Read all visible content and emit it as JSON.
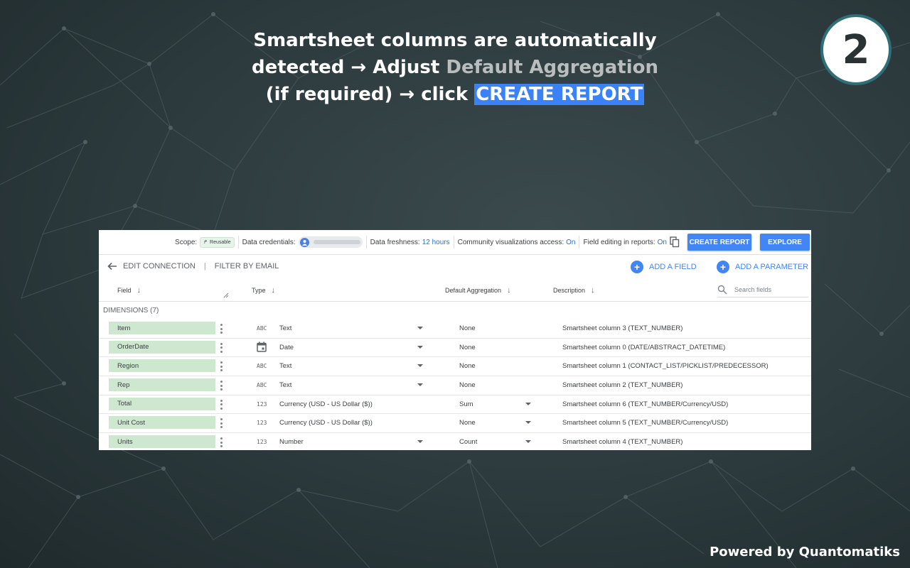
{
  "headline": {
    "line1": "Smartsheet columns are automatically",
    "line2_pre": "detected → Adjust ",
    "line2_gray": "Default Aggregation",
    "line3_pre": "(if required) → click ",
    "line3_highlight": "CREATE REPORT"
  },
  "step_number": "2",
  "footer": "Powered by Quantomatiks",
  "topbar": {
    "scope_label": "Scope:",
    "scope_chip": "Reusable",
    "credentials_label": "Data credentials:",
    "freshness_label": "Data freshness:",
    "freshness_value": "12 hours",
    "community_label": "Community visualizations access:",
    "community_value": "On",
    "field_editing_label": "Field editing in reports:",
    "field_editing_value": "On",
    "create_report": "CREATE REPORT",
    "explore": "EXPLORE"
  },
  "toolbar": {
    "edit_connection": "EDIT CONNECTION",
    "separator": "|",
    "filter_by_email": "FILTER BY EMAIL",
    "add_field": "ADD A FIELD",
    "add_parameter": "ADD A PARAMETER"
  },
  "columns": {
    "field": "Field",
    "type": "Type",
    "default_aggregation": "Default Aggregation",
    "description": "Description",
    "search_placeholder": "Search fields"
  },
  "dimensions_label": "DIMENSIONS (7)",
  "rows": [
    {
      "field": "Item",
      "type_icon": "ABC",
      "type": "Text",
      "aggregation": "None",
      "description": "Smartsheet column 3 (TEXT_NUMBER)"
    },
    {
      "field": "OrderDate",
      "type_icon": "calendar",
      "type": "Date",
      "aggregation": "None",
      "description": "Smartsheet column 0 (DATE/ABSTRACT_DATETIME)"
    },
    {
      "field": "Region",
      "type_icon": "ABC",
      "type": "Text",
      "aggregation": "None",
      "description": "Smartsheet column 1 (CONTACT_LIST/PICKLIST/PREDECESSOR)"
    },
    {
      "field": "Rep",
      "type_icon": "ABC",
      "type": "Text",
      "aggregation": "None",
      "description": "Smartsheet column 2 (TEXT_NUMBER)"
    },
    {
      "field": "Total",
      "type_icon": "123",
      "type": "Currency (USD - US Dollar ($))",
      "aggregation": "Sum",
      "description": "Smartsheet column 6 (TEXT_NUMBER/Currency/USD)"
    },
    {
      "field": "Unit Cost",
      "type_icon": "123",
      "type": "Currency (USD - US Dollar ($))",
      "aggregation": "None",
      "description": "Smartsheet column 5 (TEXT_NUMBER/Currency/USD)"
    },
    {
      "field": "Units",
      "type_icon": "123",
      "type": "Number",
      "aggregation": "Count",
      "description": "Smartsheet column 4 (TEXT_NUMBER)"
    }
  ],
  "colors": {
    "accent": "#4285f4",
    "field_pill": "#cde8cf",
    "highlight": "#3b82f6"
  }
}
